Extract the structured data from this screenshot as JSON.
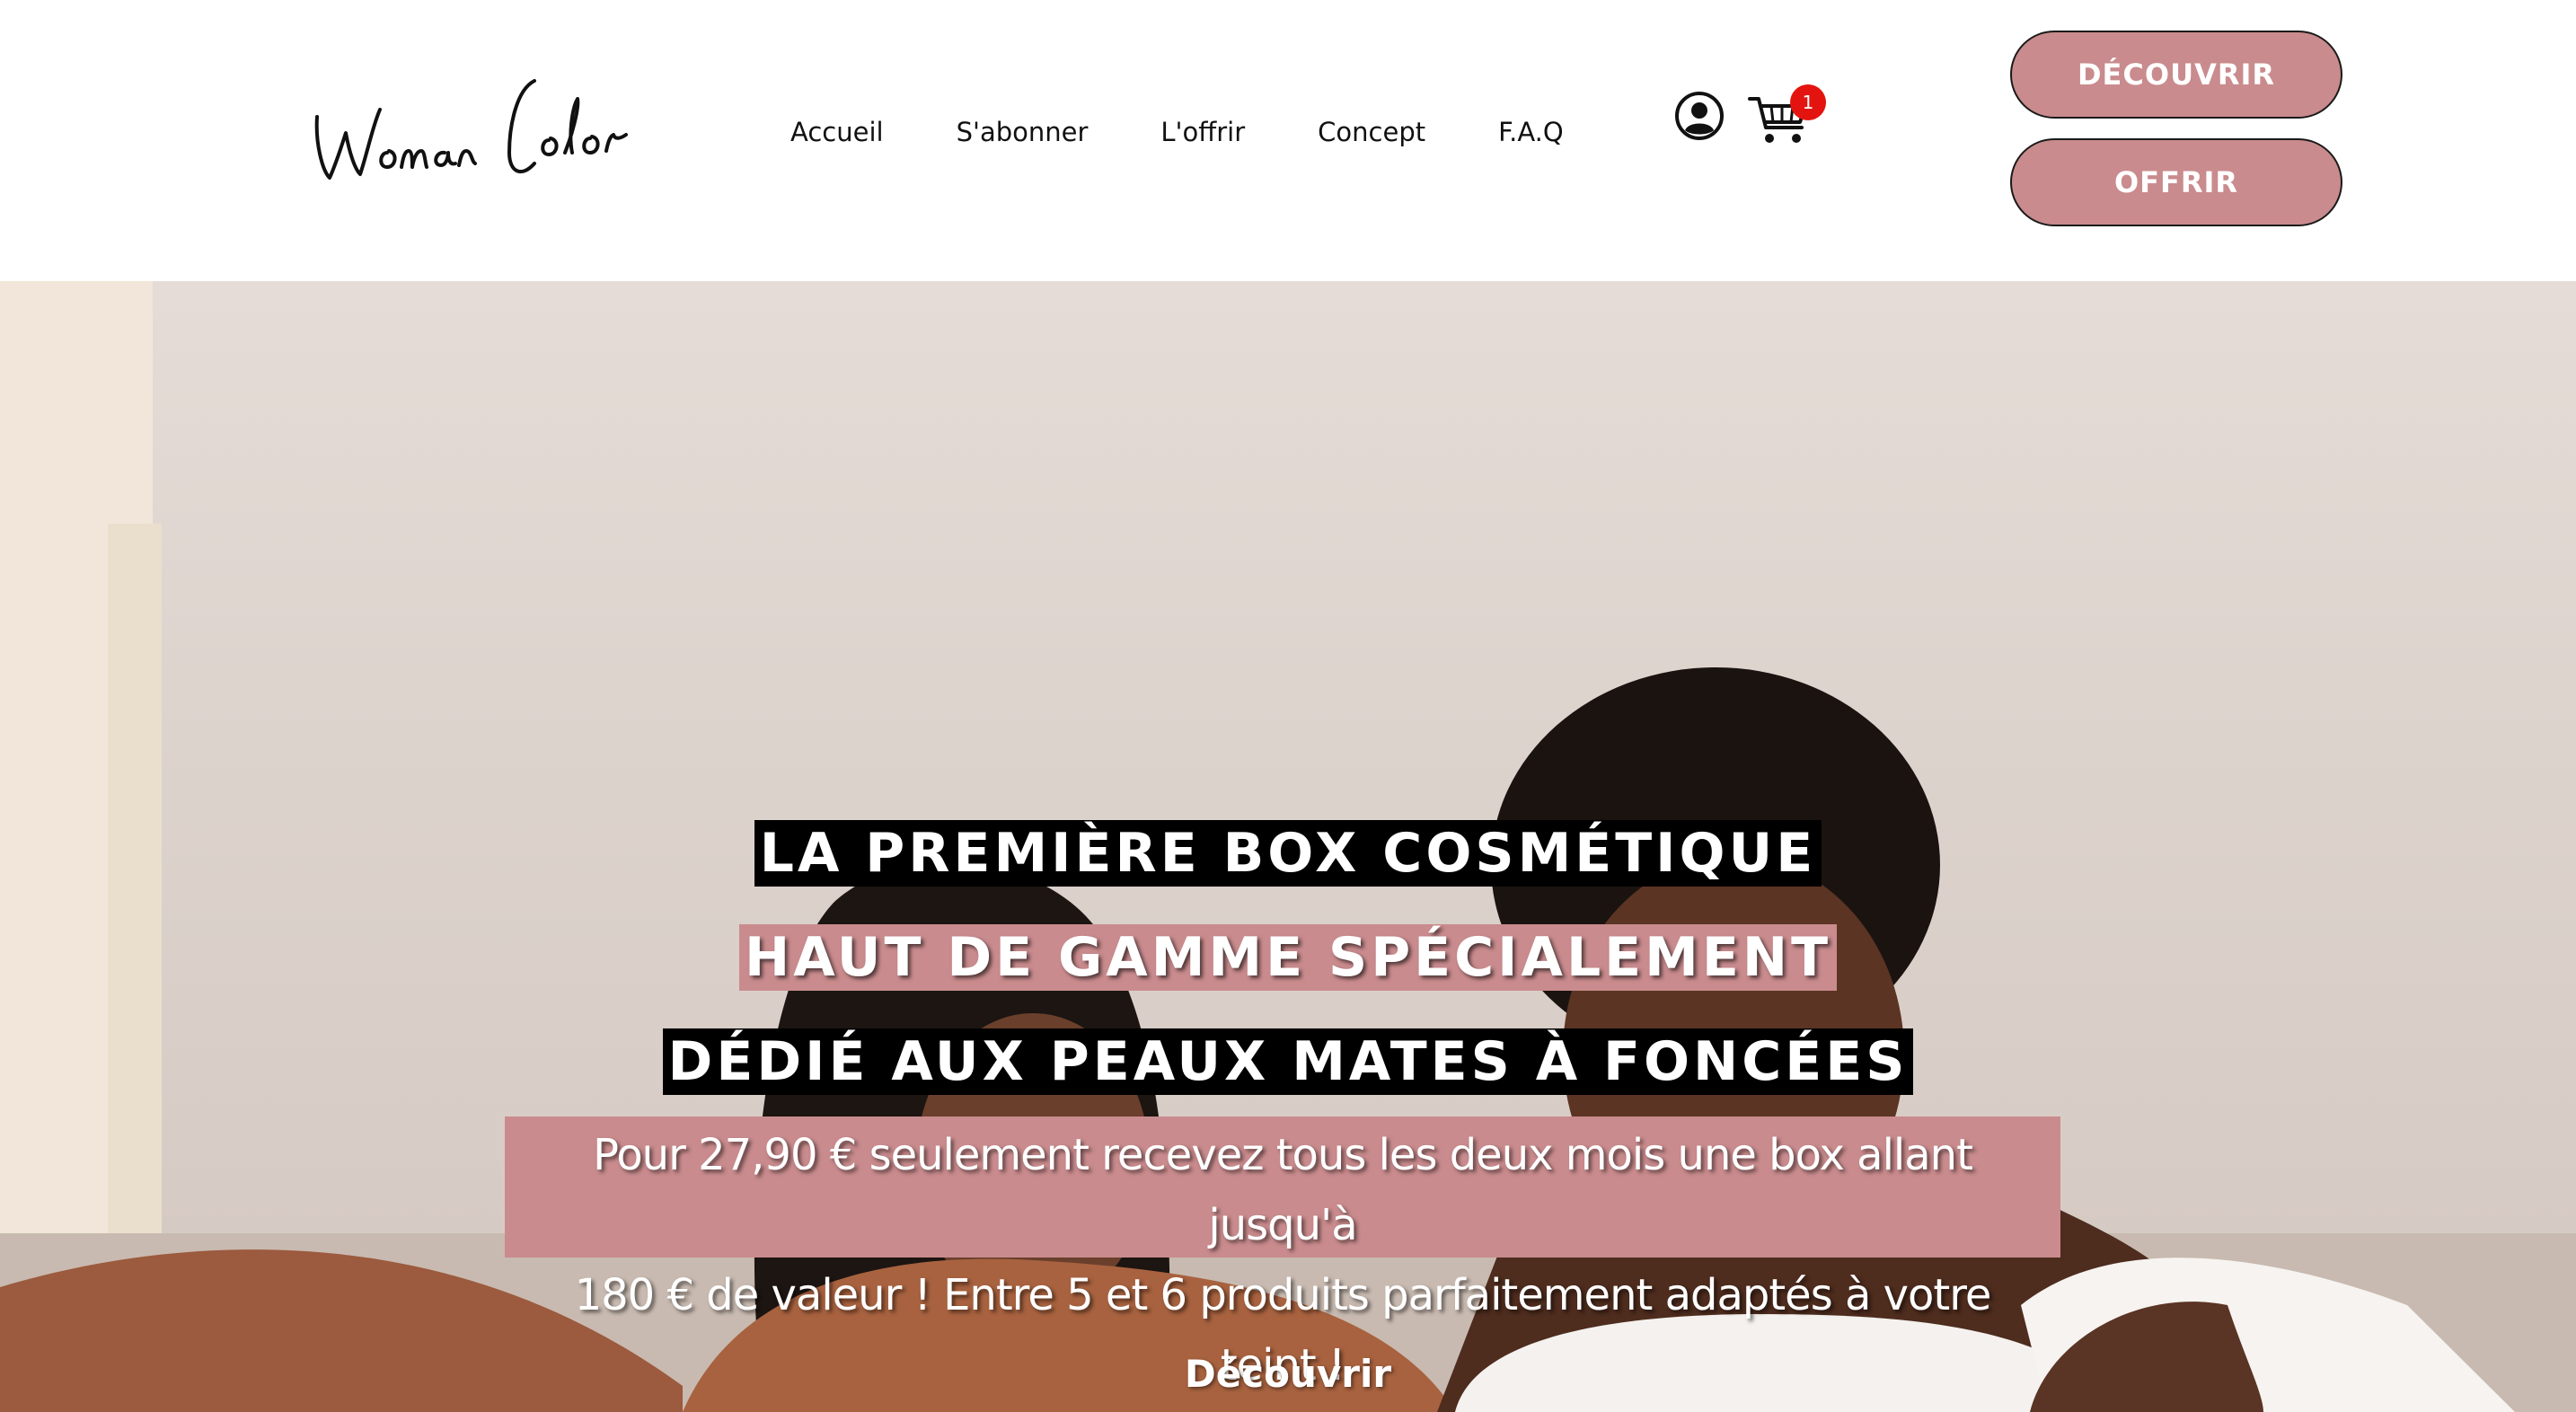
{
  "brand": {
    "logo_text": "Woman Color"
  },
  "nav": {
    "items": [
      {
        "label": "Accueil"
      },
      {
        "label": "S'abonner"
      },
      {
        "label": "L'offrir"
      },
      {
        "label": "Concept"
      },
      {
        "label": "F.A.Q"
      }
    ]
  },
  "cart": {
    "count": "1"
  },
  "buttons": {
    "discover": "DÉCOUVRIR",
    "gift": "OFFRIR"
  },
  "hero": {
    "line1": "LA PREMIÈRE BOX COSMÉTIQUE",
    "line2": "HAUT DE GAMME SPÉCIALEMENT",
    "line3": "DÉDIÉ AUX PEAUX MATES À FONCÉES",
    "subtitle_line1": "Pour 27,90 € seulement recevez tous les deux mois une box allant jusqu'à",
    "subtitle_line2": "180 € de valeur ! Entre 5 et 6 produits parfaitement adaptés à votre teint !",
    "link": "Découvrir"
  },
  "colors": {
    "accent": "#c98b8d",
    "badge": "#e3140f",
    "highlight_dark": "#000000"
  },
  "icons": [
    "user-account-icon",
    "shopping-cart-icon"
  ]
}
